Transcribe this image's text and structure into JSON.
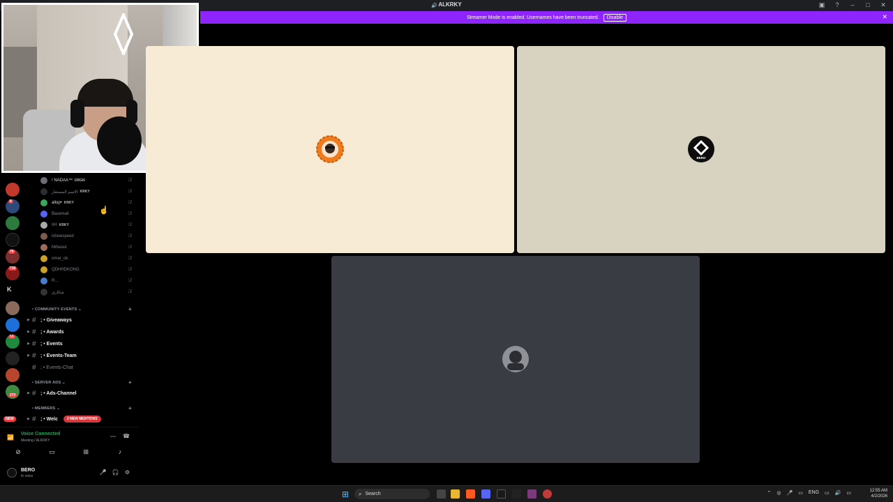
{
  "window": {
    "title": "ALKRKY"
  },
  "banner": {
    "text": "Streamer Mode is enabled. Usernames have been truncated.",
    "button": "Disable"
  },
  "rail": {
    "badges": [
      "8",
      "78",
      "716",
      "13",
      "273"
    ],
    "letter": "K",
    "new_label": "NEW"
  },
  "voice_users": [
    {
      "name": "! NADAA™",
      "tag": "DRGN",
      "bright": true,
      "color": "#6d6f78"
    },
    {
      "name": "الاسم المستعار",
      "tag": "KRKY",
      "bright": false,
      "color": "#2b2d31"
    },
    {
      "name": "allop•",
      "tag": "KRKY",
      "bright": true,
      "color": "#3ba55c"
    },
    {
      "name": "Basemali",
      "tag": "",
      "bright": false,
      "color": "#5865f2"
    },
    {
      "name": "IIH",
      "tag": "KRKY",
      "bright": true,
      "color": "#aaaaaa"
    },
    {
      "name": "ishowspeed",
      "tag": "",
      "bright": false,
      "color": "#7d5a4f"
    },
    {
      "name": "Mrbeast",
      "tag": "",
      "bright": false,
      "color": "#9b6d5a"
    },
    {
      "name": "omar_ok",
      "tag": "",
      "bright": false,
      "color": "#c9a227"
    },
    {
      "name": "QDHHDKONG",
      "tag": "",
      "bright": false,
      "color": "#c9a227"
    },
    {
      "name": "R...",
      "tag": "",
      "bright": false,
      "color": "#4a7cc9"
    },
    {
      "name": "شكاري",
      "tag": "",
      "bright": false,
      "color": "#333333"
    }
  ],
  "categories": {
    "community": "COMMUNITY EVENTS",
    "server_ads": "SERVER ADS",
    "members": "MEMBERS"
  },
  "channels": {
    "giveaways": "; • Giveaways",
    "awards": "; • Awards",
    "events": "; • Events",
    "events_team": "; • Events-Team",
    "events_chat": "; • Events-Chat",
    "ads_channel": "; • Ads-Channel",
    "welcome": "; • Welc"
  },
  "mentions": "2 NEW MENTIONS",
  "voice_panel": {
    "status": "Voice Connected",
    "sub": "Meeting / ALKRKY"
  },
  "user": {
    "name": "BERO",
    "status": "In voice"
  },
  "tiles": {
    "t1_color": "#f8ebd5",
    "t2_color": "#d8d3c1",
    "t3_color": "#3a3c43",
    "t2_label": "BERO"
  },
  "taskbar": {
    "search": "Search",
    "lang": "ENG",
    "time": "12:55 AM",
    "date": "4/2/2026"
  },
  "icons": {
    "mute": "mic-off-icon",
    "headset": "headset-icon",
    "settings": "gear-icon",
    "hash": "hash-icon"
  }
}
